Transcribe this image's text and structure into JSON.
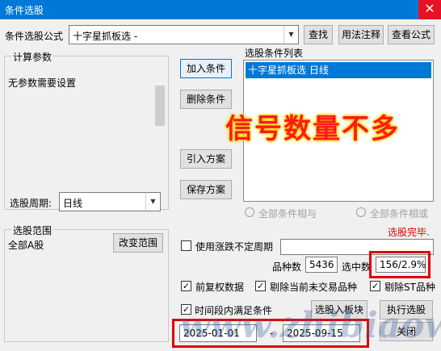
{
  "window": {
    "title": "条件选股",
    "close_glyph": "✕"
  },
  "formula": {
    "label": "条件选股公式",
    "selected": "十字星抓板选  -",
    "buttons": {
      "find": "查找",
      "usage": "用法注释",
      "view": "查看公式"
    }
  },
  "calc_params": {
    "legend": "计算参数",
    "text": "无参数需要设置"
  },
  "middle_buttons": {
    "add": "加入条件",
    "delete": "删除条件",
    "import": "引入方案",
    "save": "保存方案"
  },
  "condition_list": {
    "label": "选股条件列表",
    "items": [
      "十字星抓板选  日线"
    ]
  },
  "overlay_text": "信号数量不多",
  "period": {
    "label": "选股周期:",
    "value": "日线"
  },
  "logic": {
    "and_label": "全部条件相与",
    "or_label": "全部条件相或"
  },
  "status": "选股完毕.",
  "range": {
    "legend": "选股范围",
    "value": "全部A股",
    "change_button": "改变范围"
  },
  "uncertain_period": {
    "label": "使用涨跌不定周期",
    "checked": false
  },
  "counts": {
    "total_label": "品种数",
    "total_value": "5436",
    "selected_label": "选中数",
    "selected_value": "156/2.9%"
  },
  "options": {
    "fq": {
      "label": "前复权数据",
      "checked": true
    },
    "exclude_untraded": {
      "label": "剔除当前未交易品种",
      "checked": true
    },
    "exclude_st": {
      "label": "剔除ST品种",
      "checked": true
    },
    "time_range": {
      "label": "时间段内满足条件",
      "checked": true
    }
  },
  "actions": {
    "to_board": "选股入板块",
    "execute": "执行选股",
    "close": "关闭"
  },
  "dates": {
    "start": "2025-01-01",
    "separator": "-",
    "end": "2025-09-15"
  },
  "watermark": "www.zhibiaow.com",
  "colors": {
    "title_bar": "#0078d7",
    "list_selected": "#0078d7",
    "alert_red": "#e00000"
  }
}
